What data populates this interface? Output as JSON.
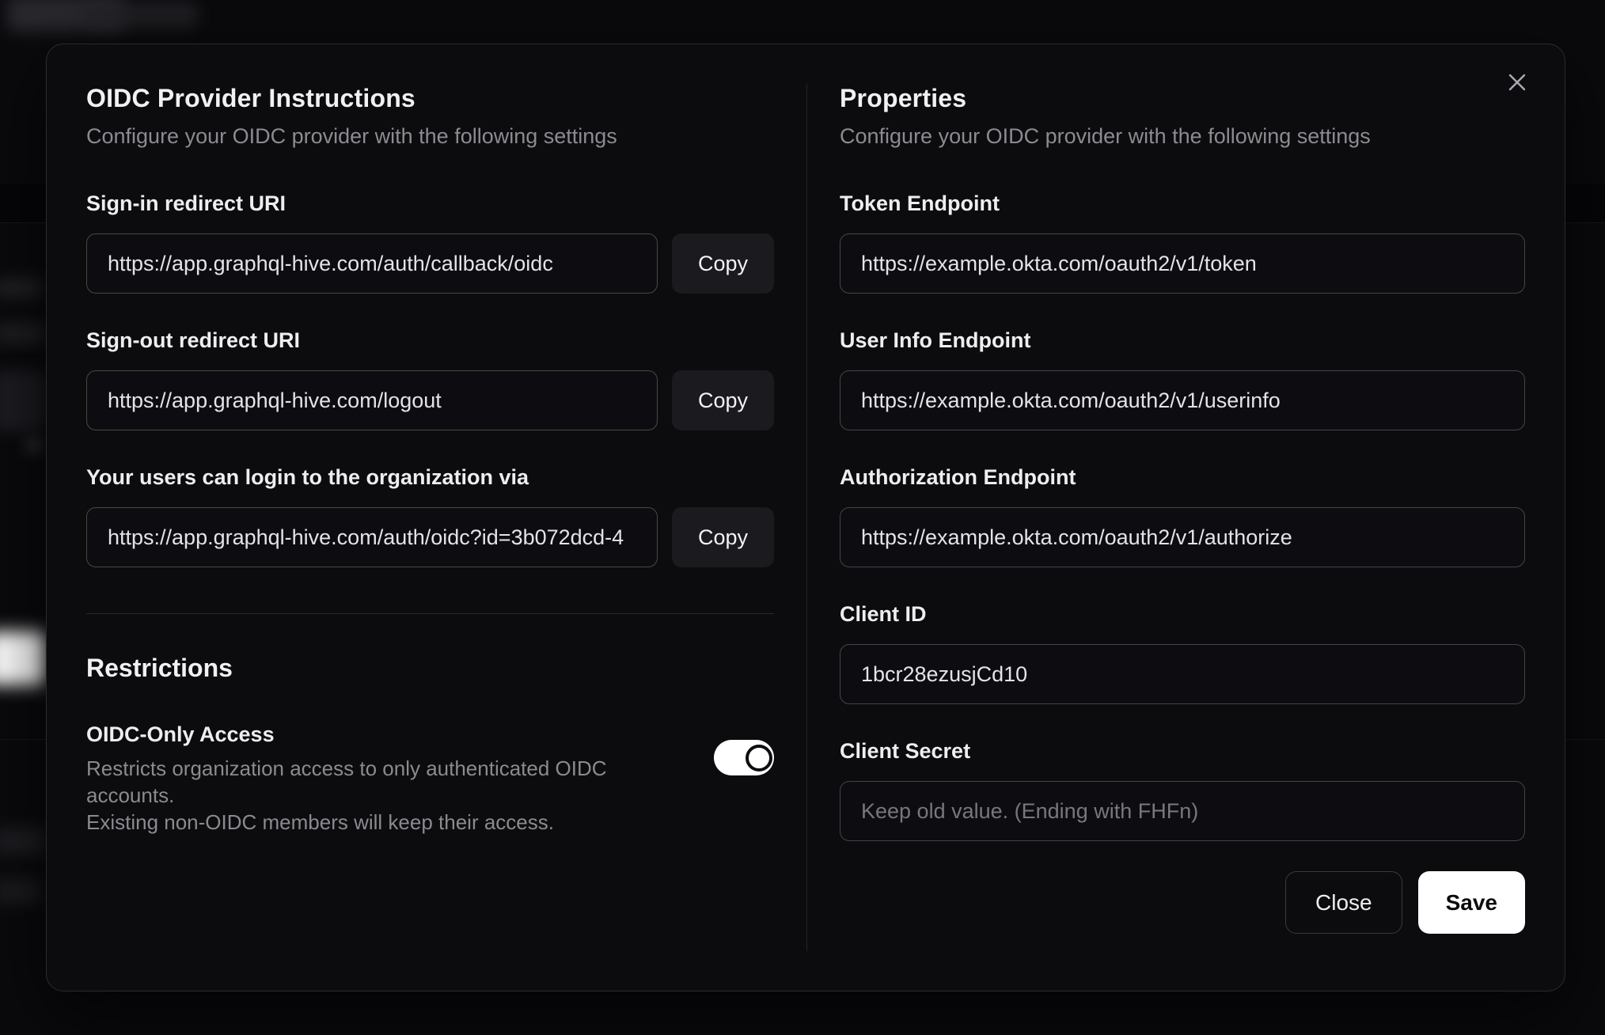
{
  "modal": {
    "left": {
      "title": "OIDC Provider Instructions",
      "subtitle": "Configure your OIDC provider with the following settings",
      "fields": [
        {
          "label": "Sign-in redirect URI",
          "value": "https://app.graphql-hive.com/auth/callback/oidc",
          "copy_label": "Copy"
        },
        {
          "label": "Sign-out redirect URI",
          "value": "https://app.graphql-hive.com/logout",
          "copy_label": "Copy"
        },
        {
          "label": "Your users can login to the organization via",
          "value": "https://app.graphql-hive.com/auth/oidc?id=3b072dcd-4",
          "copy_label": "Copy"
        }
      ],
      "restrictions": {
        "title": "Restrictions",
        "toggle_label": "OIDC-Only Access",
        "toggle_description_line1": "Restricts organization access to only authenticated OIDC accounts.",
        "toggle_description_line2": "Existing non-OIDC members will keep their access.",
        "toggle_state": "on"
      }
    },
    "right": {
      "title": "Properties",
      "subtitle": "Configure your OIDC provider with the following settings",
      "fields": [
        {
          "label": "Token Endpoint",
          "value": "https://example.okta.com/oauth2/v1/token"
        },
        {
          "label": "User Info Endpoint",
          "value": "https://example.okta.com/oauth2/v1/userinfo"
        },
        {
          "label": "Authorization Endpoint",
          "value": "https://example.okta.com/oauth2/v1/authorize"
        },
        {
          "label": "Client ID",
          "value": "1bcr28ezusjCd10"
        },
        {
          "label": "Client Secret",
          "value": "",
          "placeholder": "Keep old value. (Ending with FHFn)"
        }
      ],
      "buttons": {
        "close": "Close",
        "save": "Save"
      }
    },
    "close_icon": "✕"
  },
  "colors": {
    "modal_background": "#0c0c0f",
    "save_button_background": "#ffffff",
    "toggle_on": "#ffffff",
    "input_border": "#45434a"
  }
}
